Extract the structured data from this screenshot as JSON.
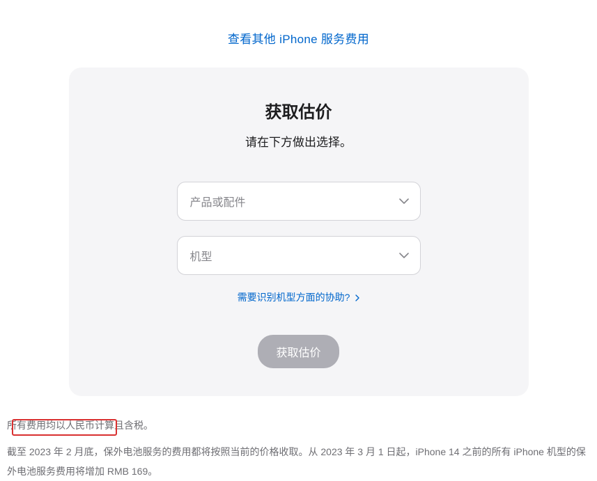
{
  "topLink": "查看其他 iPhone 服务费用",
  "card": {
    "title": "获取估价",
    "subtitle": "请在下方做出选择。",
    "select1Placeholder": "产品或配件",
    "select2Placeholder": "机型",
    "helpLink": "需要识别机型方面的协助?",
    "buttonLabel": "获取估价"
  },
  "footer": {
    "line1": "所有费用均以人民币计算且含税。",
    "line2": "截至 2023 年 2 月底，保外电池服务的费用都将按照当前的价格收取。从 2023 年 3 月 1 日起，iPhone 14 之前的所有 iPhone 机型的保外电池服务费用将增加 RMB 169。"
  }
}
